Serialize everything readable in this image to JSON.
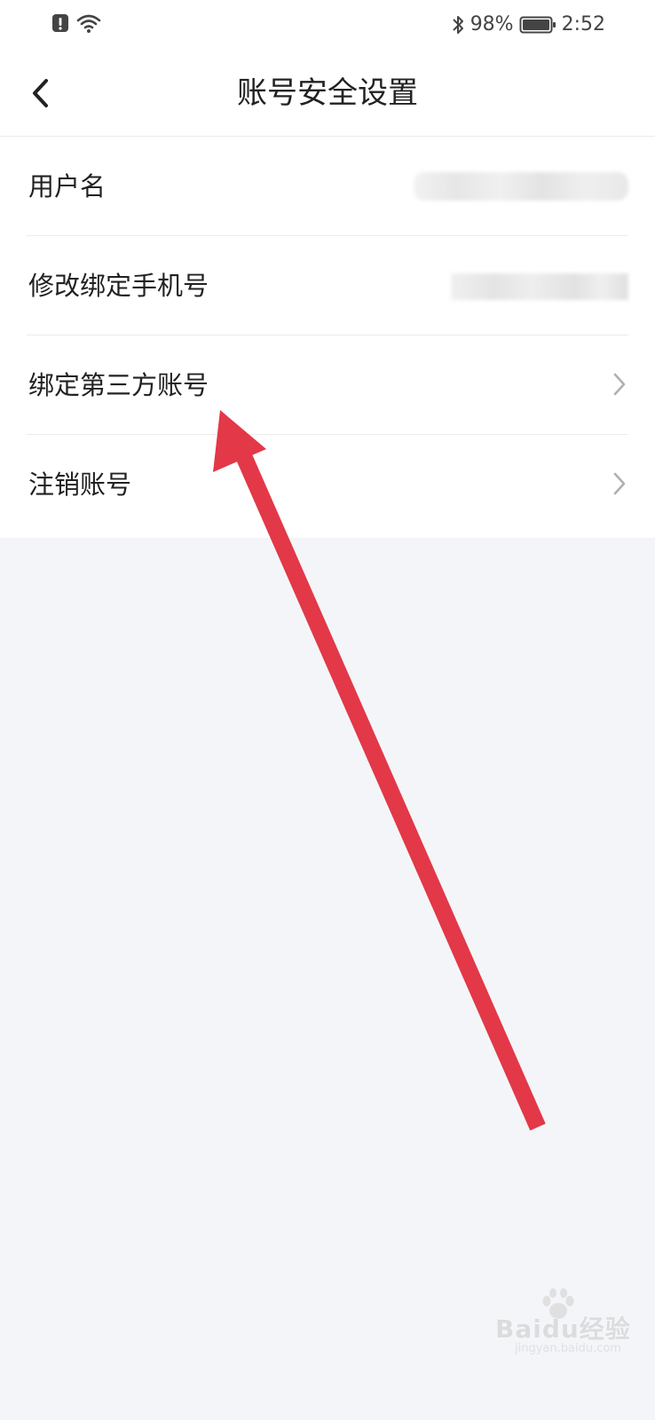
{
  "status_bar": {
    "battery": "98%",
    "time": "2:52",
    "icons": [
      "alert-icon",
      "wifi-icon",
      "bluetooth-icon",
      "battery-icon"
    ]
  },
  "header": {
    "title": "账号安全设置",
    "back_icon": "chevron-left-icon"
  },
  "settings": {
    "items": [
      {
        "label": "用户名",
        "value": "",
        "value_redacted": true,
        "chevron": false
      },
      {
        "label": "修改绑定手机号",
        "value": "",
        "value_redacted": true,
        "chevron": false
      },
      {
        "label": "绑定第三方账号",
        "chevron": true
      },
      {
        "label": "注销账号",
        "chevron": true
      }
    ]
  },
  "annotation": {
    "color": "#e23848",
    "icon": "red-arrow-annotation"
  },
  "watermark": {
    "main": "Baidu经验",
    "sub": "jingyan.baidu.com"
  },
  "colors": {
    "background": "#f4f5f8",
    "surface": "#ffffff",
    "text": "#222222",
    "chevron": "#b0b0b0",
    "divider": "#ececec"
  }
}
